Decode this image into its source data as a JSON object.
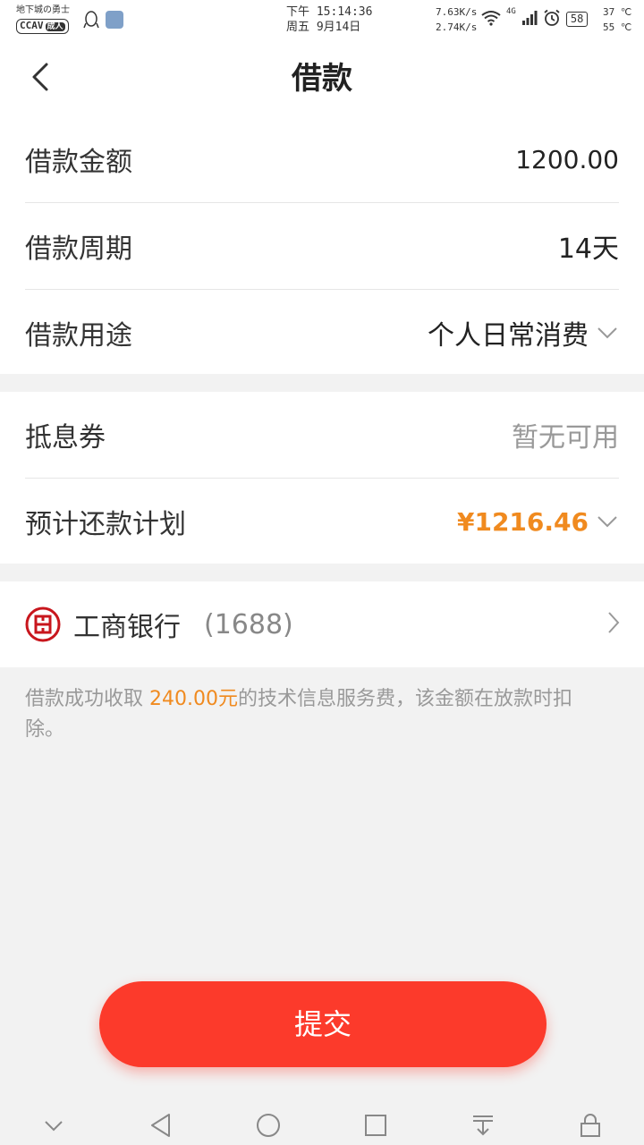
{
  "status_bar": {
    "brand_line1": "地下城の勇士",
    "brand_line2": "CCAV",
    "brand_badge": "成人",
    "time": "下午 15:14:36",
    "date": "周五 9月14日",
    "speed_up": "7.63K/s",
    "speed_down": "2.74K/s",
    "network": "4G",
    "battery": "58",
    "temp1": "37 ℃",
    "temp2": "55 ℃"
  },
  "header": {
    "title": "借款"
  },
  "loan": {
    "amount_label": "借款金额",
    "amount_value": "1200.00",
    "period_label": "借款周期",
    "period_value": "14天",
    "purpose_label": "借款用途",
    "purpose_value": "个人日常消费"
  },
  "repay": {
    "coupon_label": "抵息券",
    "coupon_value": "暂无可用",
    "plan_label": "预计还款计划",
    "plan_value": "¥1216.46"
  },
  "bank": {
    "name": "工商银行",
    "card": "(1688)"
  },
  "notice": {
    "prefix": "借款成功收取 ",
    "fee": "240.00元",
    "suffix": "的技术信息服务费，该金额在放款时扣除。"
  },
  "submit_label": "提交",
  "colors": {
    "accent": "#fc3a2b",
    "highlight": "#f08a1f"
  }
}
